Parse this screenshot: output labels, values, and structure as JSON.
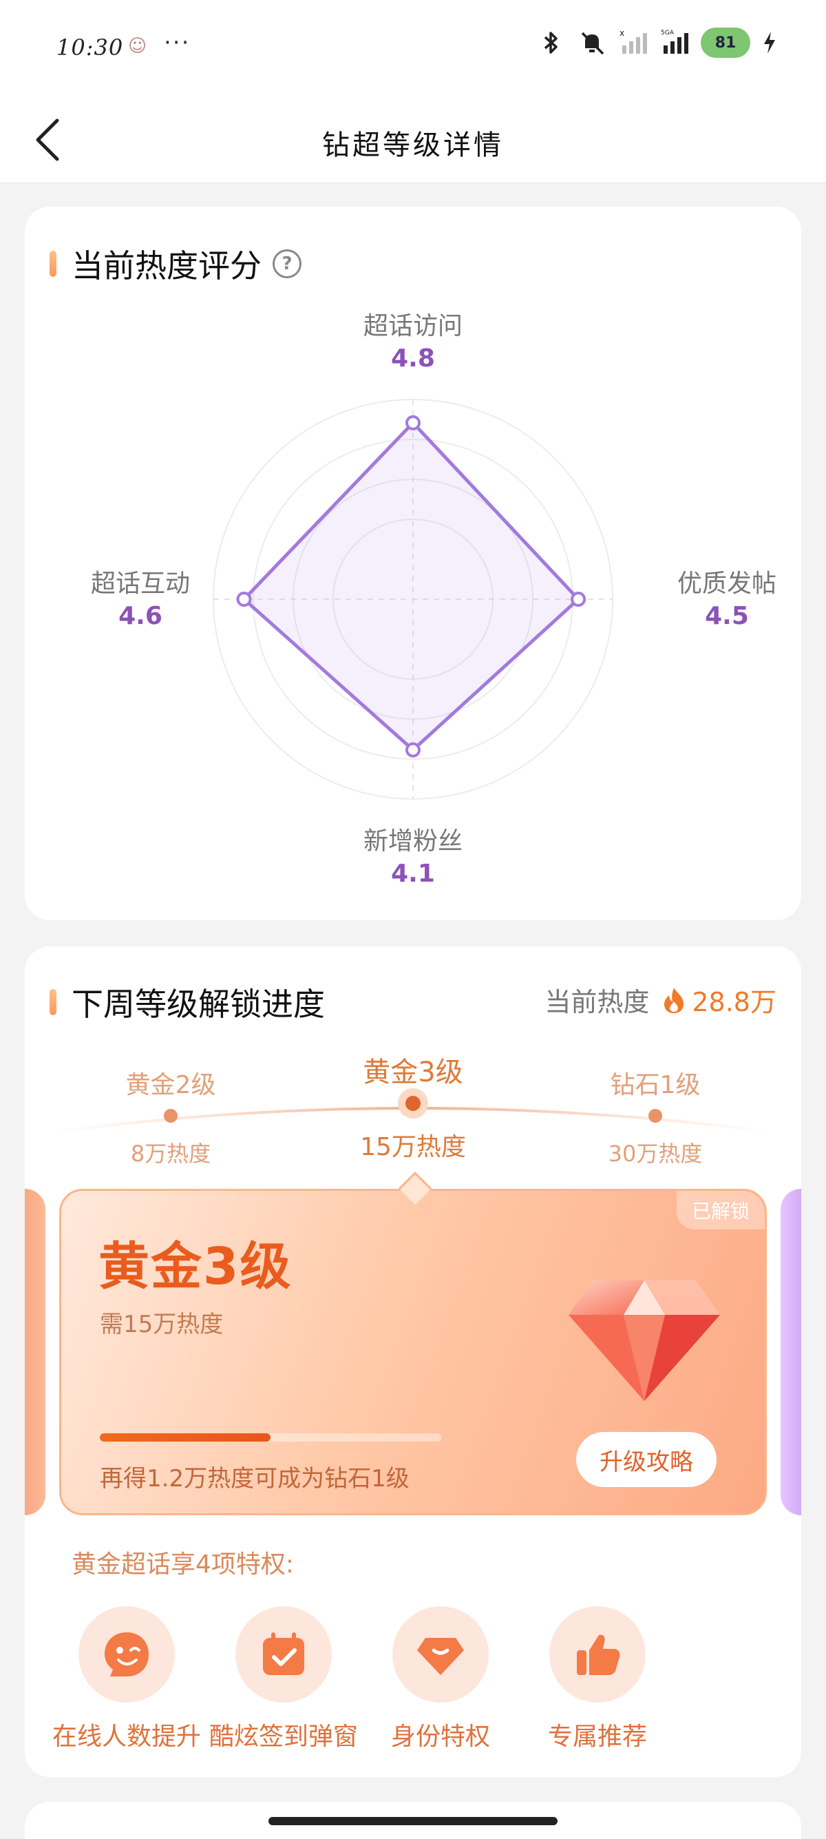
{
  "status_bar": {
    "time": "10:30",
    "dots": "···",
    "battery": "81"
  },
  "header": {
    "title": "钻超等级详情"
  },
  "heat_score": {
    "title": "当前热度评分",
    "help_icon": "question-icon",
    "accent_color": "#8c52b8",
    "axes": [
      {
        "label": "超话访问",
        "value": 4.8
      },
      {
        "label": "优质发帖",
        "value": 4.5
      },
      {
        "label": "新增粉丝",
        "value": 4.1
      },
      {
        "label": "超话互动",
        "value": 4.6
      }
    ],
    "max": 5
  },
  "unlock": {
    "title": "下周等级解锁进度",
    "current_heat_label": "当前热度",
    "current_heat_value": "28.8万",
    "levels": [
      {
        "name": "黄金2级",
        "heat": "8万热度"
      },
      {
        "name": "黄金3级",
        "heat": "15万热度"
      },
      {
        "name": "钻石1级",
        "heat": "30万热度"
      }
    ],
    "card": {
      "badge": "已解锁",
      "level": "黄金3级",
      "need": "需15万热度",
      "progress_fraction": 0.5,
      "progress_text": "再得1.2万热度可成为钻石1级",
      "upgrade_button": "升级攻略"
    },
    "privilege_title": "黄金超话享4项特权:",
    "privileges": [
      {
        "label": "在线人数提升",
        "icon": "wink-face-icon"
      },
      {
        "label": "酷炫签到弹窗",
        "icon": "calendar-check-icon"
      },
      {
        "label": "身份特权",
        "icon": "diamond-icon"
      },
      {
        "label": "专属推荐",
        "icon": "thumbs-up-icon"
      }
    ],
    "brand_color": "#e95c1d"
  }
}
